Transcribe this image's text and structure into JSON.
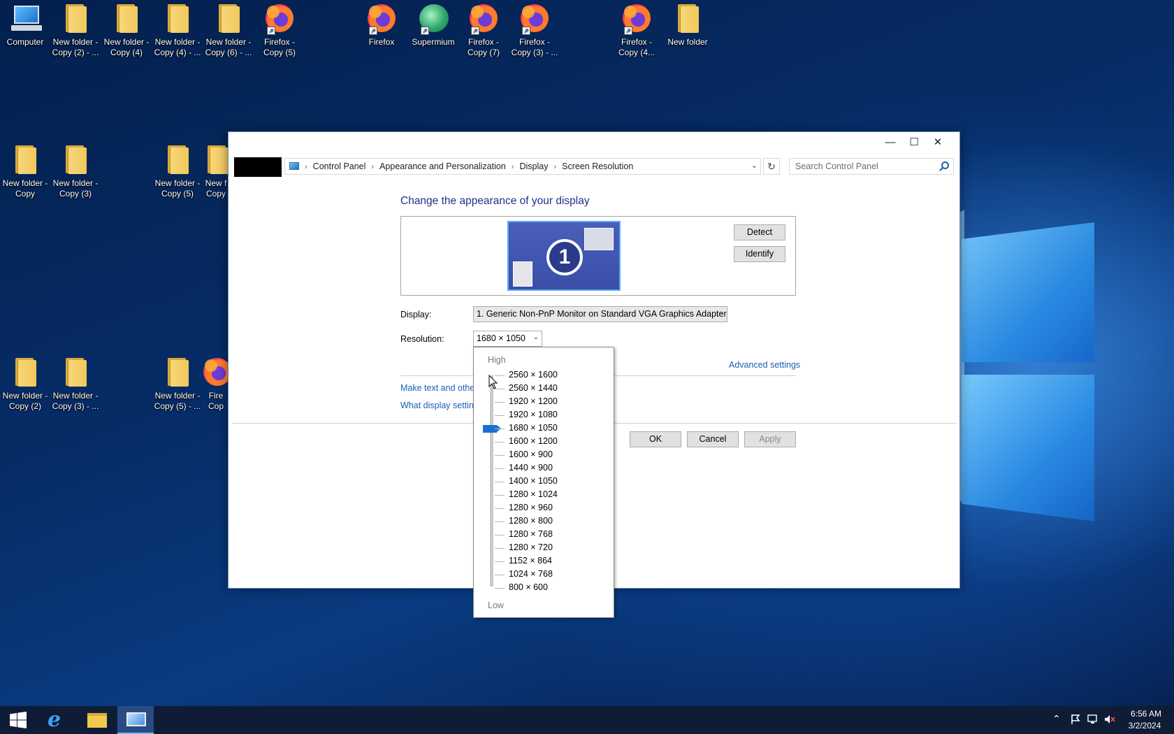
{
  "desktop": {
    "icons": [
      {
        "label": "Computer",
        "type": "computer-icon"
      },
      {
        "label": "New folder - Copy (2) - ...",
        "type": "folder-icon"
      },
      {
        "label": "New folder - Copy (4)",
        "type": "folder-icon"
      },
      {
        "label": "New folder - Copy (4) - ...",
        "type": "folder-icon"
      },
      {
        "label": "New folder - Copy (6) - ...",
        "type": "folder-icon"
      },
      {
        "label": "Firefox - Copy (5)",
        "type": "firefox-icon"
      },
      {
        "label": "Firefox",
        "type": "firefox-icon"
      },
      {
        "label": "Supermium",
        "type": "supermium-icon"
      },
      {
        "label": "Firefox - Copy (7)",
        "type": "firefox-icon"
      },
      {
        "label": "Firefox - Copy (3) - ...",
        "type": "firefox-icon"
      },
      {
        "label": "Firefox - Copy (4...",
        "type": "firefox-icon"
      },
      {
        "label": "New folder",
        "type": "folder-icon"
      },
      {
        "label": "New folder - Copy",
        "type": "folder-icon"
      },
      {
        "label": "New folder - Copy (3)",
        "type": "folder-icon"
      },
      {
        "label": "New folder - Copy (5)",
        "type": "folder-icon"
      },
      {
        "label": "New f Copy",
        "type": "folder-icon"
      },
      {
        "label": "New folder - Copy (2)",
        "type": "folder-icon"
      },
      {
        "label": "New folder - Copy (3) - ...",
        "type": "folder-icon"
      },
      {
        "label": "New folder - Copy (5) - ...",
        "type": "folder-icon"
      },
      {
        "label": "Fire Cop",
        "type": "firefox-icon"
      }
    ]
  },
  "window": {
    "controls": {
      "minimize": "—",
      "maximize": "☐",
      "close": "✕"
    },
    "address": {
      "crumbs": [
        "Control Panel",
        "Appearance and Personalization",
        "Display",
        "Screen Resolution"
      ],
      "search_placeholder": "Search Control Panel"
    },
    "heading": "Change the appearance of your display",
    "monitor_number": "1",
    "detect_label": "Detect",
    "identify_label": "Identify",
    "display_label": "Display:",
    "display_value": "1. Generic Non-PnP Monitor on Standard VGA Graphics Adapter",
    "resolution_label": "Resolution:",
    "resolution_value": "1680 × 1050",
    "advanced_link": "Advanced settings",
    "link_text_size": "Make text and other",
    "link_display_settings": "What display setting",
    "ok_label": "OK",
    "cancel_label": "Cancel",
    "apply_label": "Apply"
  },
  "resolution_dropdown": {
    "high_label": "High",
    "low_label": "Low",
    "options": [
      "2560 × 1600",
      "2560 × 1440",
      "1920 × 1200",
      "1920 × 1080",
      "1680 × 1050",
      "1600 × 1200",
      "1600 × 900",
      "1440 × 900",
      "1400 × 1050",
      "1280 × 1024",
      "1280 × 960",
      "1280 × 800",
      "1280 × 768",
      "1280 × 720",
      "1152 × 864",
      "1024 × 768",
      "800 × 600"
    ],
    "selected": "1680 × 1050"
  },
  "taskbar": {
    "time": "6:56 AM",
    "date": "3/2/2024"
  },
  "colors": {
    "accent": "#1a6fd4",
    "heading": "#1e3287",
    "link": "#1a5fb4"
  }
}
